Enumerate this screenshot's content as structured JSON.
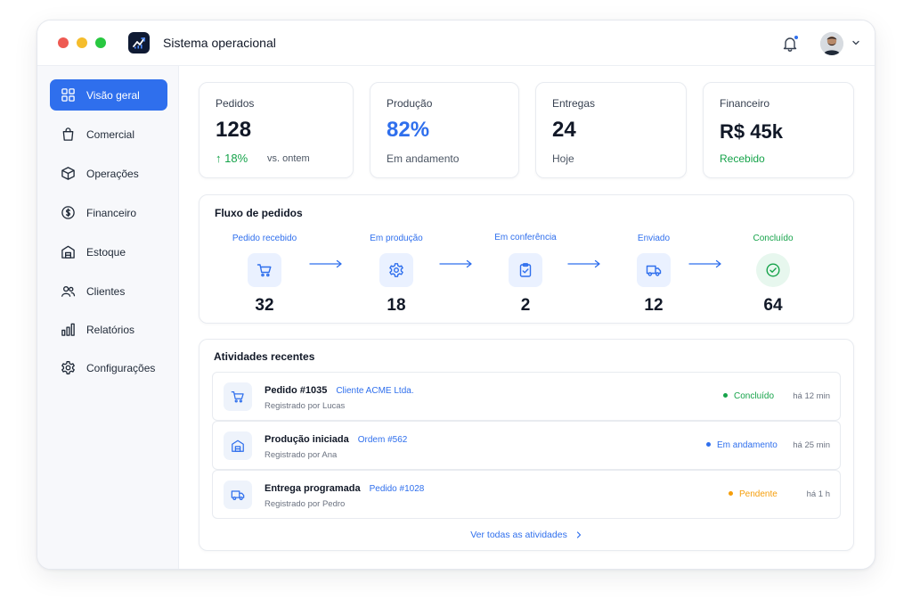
{
  "app": {
    "title": "Sistema operacional"
  },
  "sidebar": {
    "items": [
      {
        "label": "Visão geral",
        "icon": "grid-icon",
        "active": true
      },
      {
        "label": "Comercial",
        "icon": "shopping-bag-icon"
      },
      {
        "label": "Operações",
        "icon": "box-icon"
      },
      {
        "label": "Financeiro",
        "icon": "dollar-circle-icon"
      },
      {
        "label": "Estoque",
        "icon": "warehouse-icon"
      },
      {
        "label": "Clientes",
        "icon": "users-icon"
      },
      {
        "label": "Relatórios",
        "icon": "bar-chart-icon"
      },
      {
        "label": "Configurações",
        "icon": "gear-icon"
      }
    ]
  },
  "stats": [
    {
      "label": "Pedidos",
      "value": "128",
      "delta": "↑ 18%",
      "sub": "vs. ontem"
    },
    {
      "label": "Produção",
      "value": "82%",
      "sub": "Em andamento",
      "value_color": "#2f6fed"
    },
    {
      "label": "Entregas",
      "value": "24",
      "sub": "Hoje"
    },
    {
      "label": "Financeiro",
      "value": "R$ 45k",
      "sub": "Recebido",
      "sub_color": "#16a34a"
    }
  ],
  "flow": {
    "title": "Fluxo de pedidos",
    "steps": [
      {
        "label": "Pedido recebido",
        "count": "32",
        "icon": "cart-icon"
      },
      {
        "label": "Em produção",
        "count": "18",
        "icon": "gear-icon"
      },
      {
        "label": "Em conferência",
        "count": "2",
        "icon": "clipboard-check-icon"
      },
      {
        "label": "Enviado",
        "count": "12",
        "icon": "truck-icon"
      },
      {
        "label": "Concluído",
        "count": "64",
        "icon": "check-circle-icon"
      }
    ]
  },
  "activities": {
    "title": "Atividades recentes",
    "items": [
      {
        "title": "Pedido #1035",
        "ref": "Cliente ACME Ltda.",
        "sub": "Registrado por Lucas",
        "status": "Concluído",
        "status_color": "#16a34a",
        "time": "há 12 min",
        "icon": "cart-icon"
      },
      {
        "title": "Produção iniciada",
        "ref": "Ordem #562",
        "sub": "Registrado por Ana",
        "status": "Em andamento",
        "status_color": "#2f6fed",
        "time": "há 25 min",
        "icon": "factory-icon"
      },
      {
        "title": "Entrega programada",
        "ref": "Pedido #1028",
        "sub": "Registrado por Pedro",
        "status": "Pendente",
        "status_color": "#f59e0b",
        "time": "há 1 h",
        "icon": "truck-icon"
      }
    ],
    "see_all": "Ver todas as atividades"
  }
}
